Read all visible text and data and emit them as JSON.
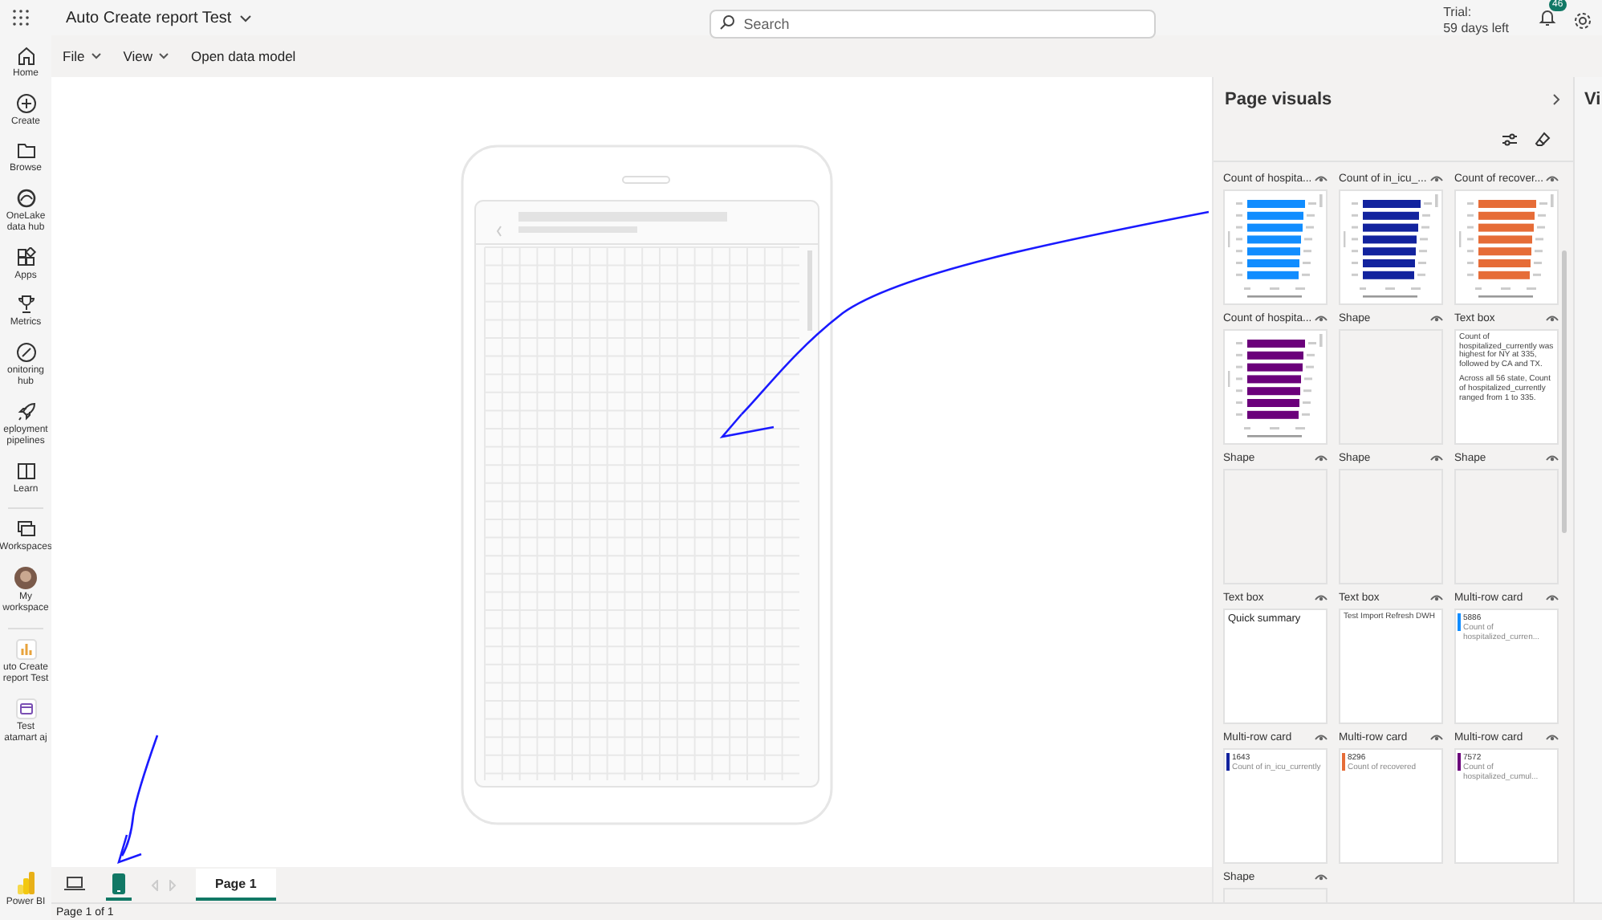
{
  "top_bar": {
    "report_name": "Auto Create report Test",
    "search": {
      "placeholder": "Search"
    },
    "trial": [
      "Trial:",
      "59 days left"
    ],
    "notifications_badge": "46"
  },
  "nav": [
    {
      "label": "Home"
    },
    {
      "label": "Create"
    },
    {
      "label": "Browse"
    },
    {
      "label": "OneLake data hub"
    },
    {
      "label": "Apps"
    },
    {
      "label": "Metrics"
    },
    {
      "label": "onitoring hub"
    },
    {
      "label": "eployment pipelines"
    },
    {
      "label": "Learn"
    },
    {
      "label": "Workspaces"
    },
    {
      "label": "My workspace"
    },
    {
      "label": "uto Create report Test"
    },
    {
      "label": "Test atamart aj"
    }
  ],
  "nav_footer": {
    "label": "Power BI"
  },
  "menu": [
    {
      "label": "File",
      "dropdown": true
    },
    {
      "label": "View",
      "dropdown": true
    },
    {
      "label": "Open data model",
      "dropdown": false
    }
  ],
  "view_toggles": [
    {
      "selected": false
    },
    {
      "selected": true
    }
  ],
  "page_tabs": [
    {
      "label": "Page 1",
      "selected": true
    }
  ],
  "status_bar": "Page 1 of 1",
  "panel": {
    "title": "Page visuals",
    "side_tab": "Vi",
    "visuals": [
      {
        "kind": "chart",
        "title": "Count of hospita...",
        "color": "#118dff"
      },
      {
        "kind": "chart",
        "title": "Count of in_icu_...",
        "color": "#12239e"
      },
      {
        "kind": "chart",
        "title": "Count of recover...",
        "color": "#e66c37"
      },
      {
        "kind": "chart",
        "title": "Count of hospita...",
        "color": "#6b007b"
      },
      {
        "kind": "shape",
        "title": "Shape"
      },
      {
        "kind": "textbox",
        "title": "Text box",
        "heading": false,
        "paragraphs": [
          "Count of hospitalized_currently was highest for NY at 335, followed by CA and TX.",
          "Across all 56 state, Count of hospitalized_currently ranged from 1 to 335."
        ]
      },
      {
        "kind": "shape",
        "title": "Shape"
      },
      {
        "kind": "shape",
        "title": "Shape"
      },
      {
        "kind": "shape",
        "title": "Shape"
      },
      {
        "kind": "textbox",
        "title": "Text box",
        "heading": true,
        "paragraphs": [
          "Quick summary"
        ]
      },
      {
        "kind": "textbox",
        "title": "Text box",
        "heading": false,
        "paragraphs": [
          "Test Import Refresh DWH"
        ]
      },
      {
        "kind": "card",
        "title": "Multi-row card",
        "value": "5886",
        "label": "Count of hospitalized_curren...",
        "color": "#118dff"
      },
      {
        "kind": "card",
        "title": "Multi-row card",
        "value": "1643",
        "label": "Count of in_icu_currently",
        "color": "#12239e"
      },
      {
        "kind": "card",
        "title": "Multi-row card",
        "value": "8296",
        "label": "Count of recovered",
        "color": "#e66c37"
      },
      {
        "kind": "card",
        "title": "Multi-row card",
        "value": "7572",
        "label": "Count of hospitalized_cumul...",
        "color": "#6b007b"
      },
      {
        "kind": "shape",
        "title": "Shape"
      }
    ]
  }
}
